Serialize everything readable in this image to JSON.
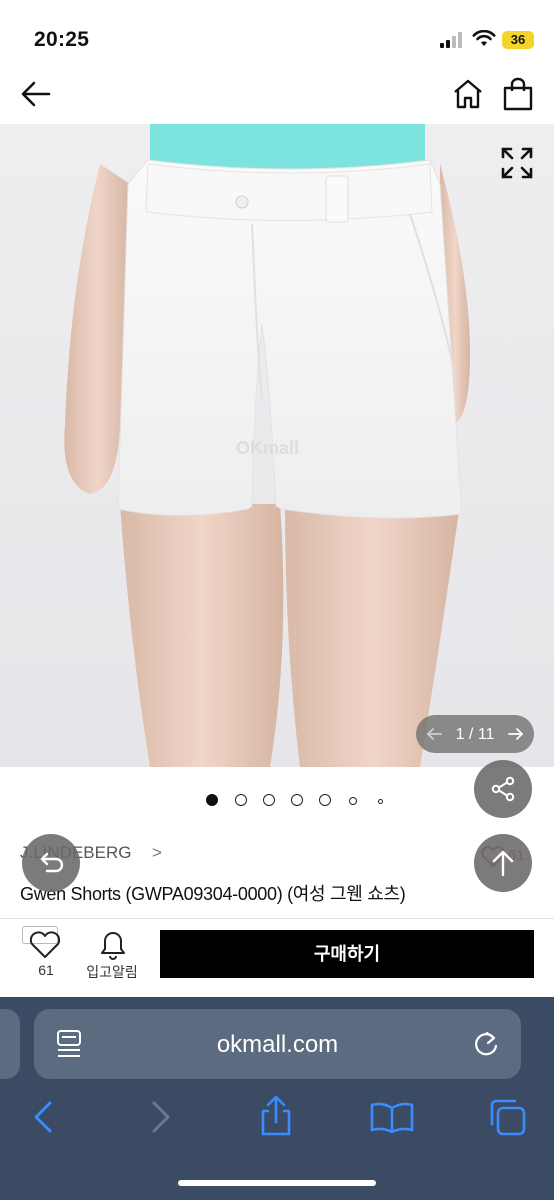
{
  "status_bar": {
    "time": "20:25",
    "battery": "36"
  },
  "gallery": {
    "counter": "1 / 11",
    "watermark": "OKmall"
  },
  "product": {
    "brand": "J.LINDEBERG",
    "brand_chevron": ">",
    "title": "Gwen Shorts (GWPA09304-0000) (여성 그웬 쇼츠)",
    "like_count_top": "61"
  },
  "actions": {
    "like_count": "61",
    "restock_label": "입고알림",
    "buy_label": "구매하기"
  },
  "browser": {
    "address": "okmall.com"
  },
  "colors": {
    "accent_buy": "#000000",
    "safari_bar": "#3a4b63",
    "safari_icon": "#3a8cff",
    "battery": "#f2d42a"
  },
  "icons": [
    "back-arrow-icon",
    "home-icon",
    "shopping-bag-icon",
    "expand-icon",
    "share-icon",
    "scroll-top-icon",
    "undo-icon",
    "heart-icon",
    "bell-icon",
    "reader-icon",
    "reload-icon",
    "browser-back-icon",
    "browser-forward-icon",
    "browser-share-icon",
    "bookmarks-icon",
    "tabs-icon"
  ]
}
